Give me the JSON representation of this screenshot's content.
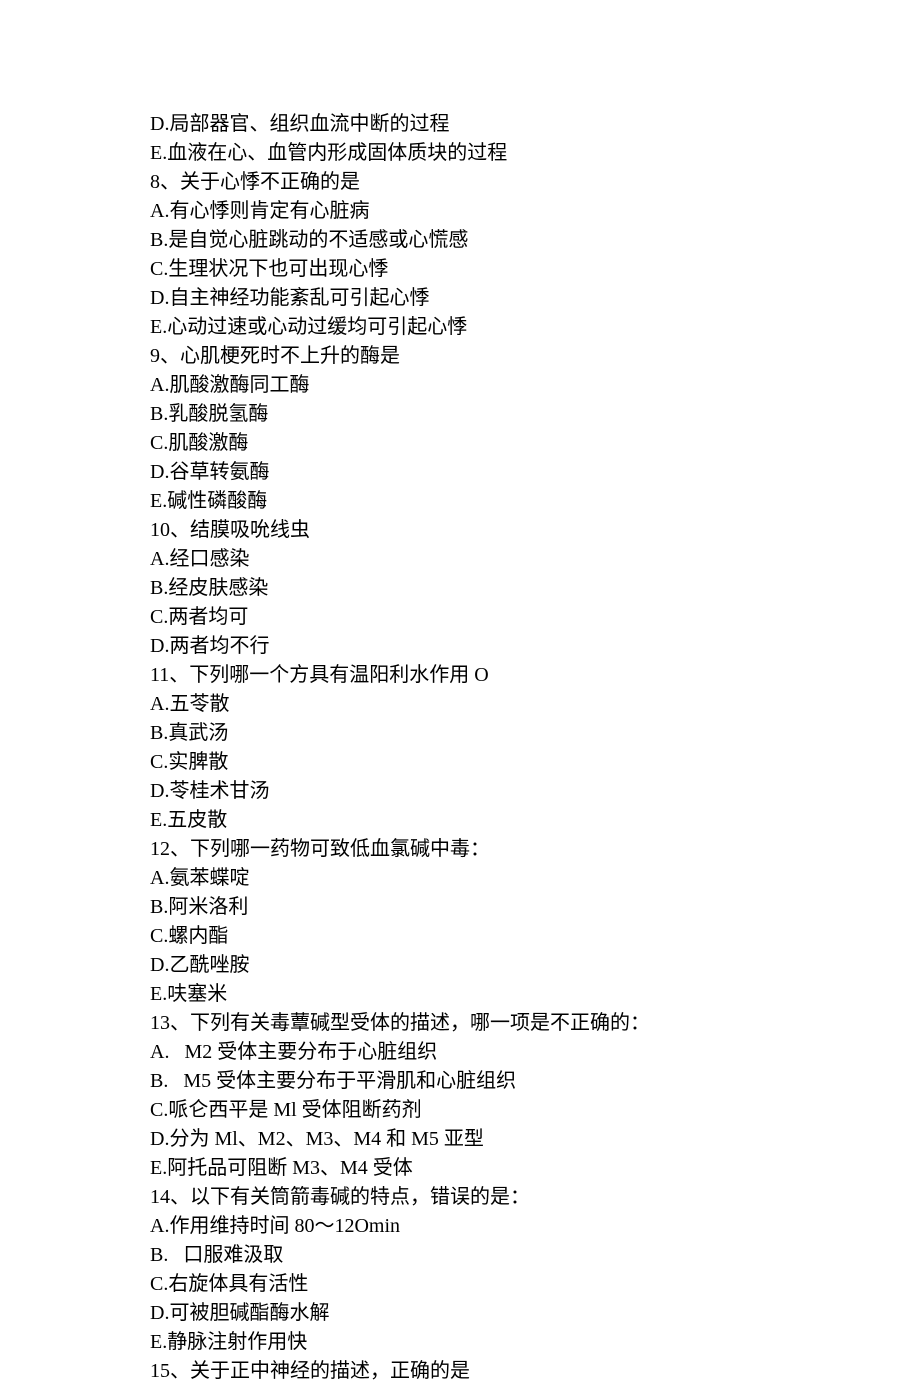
{
  "lines": [
    "D.局部器官、组织血流中断的过程",
    "E.血液在心、血管内形成固体质块的过程",
    "8、关于心悸不正确的是",
    "A.有心悸则肯定有心脏病",
    "B.是自觉心脏跳动的不适感或心慌感",
    "C.生理状况下也可出现心悸",
    "D.自主神经功能紊乱可引起心悸",
    "E.心动过速或心动过缓均可引起心悸",
    "9、心肌梗死时不上升的酶是",
    "A.肌酸激酶同工酶",
    "B.乳酸脱氢酶",
    "C.肌酸激酶",
    "D.谷草转氨酶",
    "E.碱性磷酸酶",
    "10、结膜吸吮线虫",
    "A.经口感染",
    "B.经皮肤感染",
    "C.两者均可",
    "D.两者均不行",
    "11、下列哪一个方具有温阳利水作用 O",
    "A.五苓散",
    "B.真武汤",
    "C.实脾散",
    "D.苓桂术甘汤",
    "E.五皮散",
    "12、下列哪一药物可致低血氯碱中毒：",
    "A.氨苯蝶啶",
    "B.阿米洛利",
    "C.螺内酯",
    "D.乙酰唑胺",
    "E.呋塞米",
    "13、下列有关毒蕈碱型受体的描述，哪一项是不正确的：",
    "A.   M2 受体主要分布于心脏组织",
    "B.   M5 受体主要分布于平滑肌和心脏组织",
    "C.哌仑西平是 Ml 受体阻断药剂",
    "D.分为 Ml、M2、M3、M4 和 M5 亚型",
    "E.阿托品可阻断 M3、M4 受体",
    "14、以下有关筒箭毒碱的特点，错误的是：",
    "A.作用维持时间 80～12Omin",
    "B.   口服难汲取",
    "C.右旋体具有活性",
    "D.可被胆碱酯酶水解",
    "E.静脉注射作用快",
    "15、关于正中神经的描述，正确的是"
  ]
}
